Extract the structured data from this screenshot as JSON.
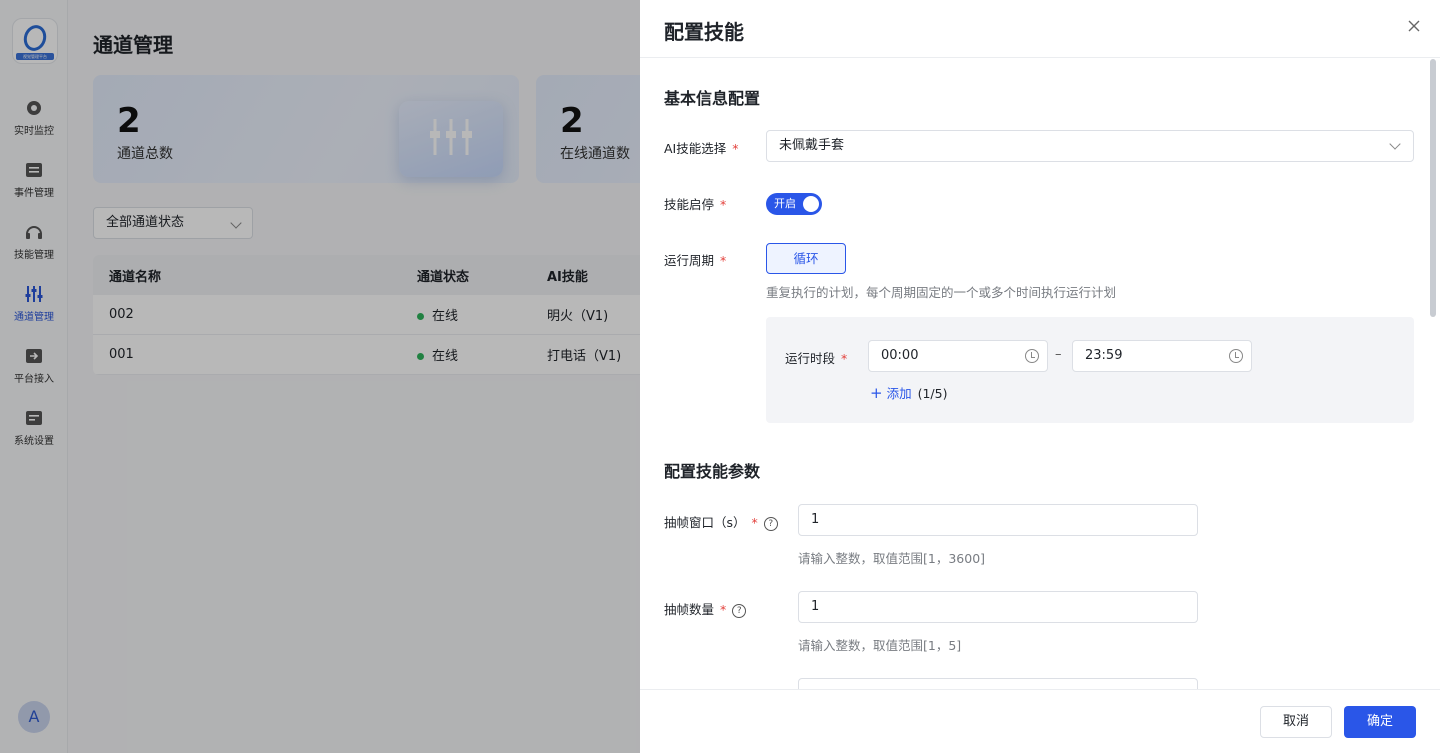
{
  "sidebar": {
    "logo_subtitle": "视觉管理平台",
    "items": [
      {
        "label": "实时监控",
        "icon": "camera-icon"
      },
      {
        "label": "事件管理",
        "icon": "list-icon"
      },
      {
        "label": "技能管理",
        "icon": "headset-icon"
      },
      {
        "label": "通道管理",
        "icon": "sliders-icon"
      },
      {
        "label": "平台接入",
        "icon": "login-icon"
      },
      {
        "label": "系统设置",
        "icon": "settings-icon"
      }
    ],
    "active_item": "通道管理",
    "avatar": "A"
  },
  "main": {
    "title": "通道管理",
    "stats": [
      {
        "value": "2",
        "label": "通道总数"
      },
      {
        "value": "2",
        "label": "在线通道数"
      }
    ],
    "filter": "全部通道状态",
    "table": {
      "headers": [
        "通道名称",
        "通道状态",
        "AI技能"
      ],
      "rows": [
        {
          "name": "002",
          "status": "在线",
          "skill": "明火（V1)"
        },
        {
          "name": "001",
          "status": "在线",
          "skill": "打电话（V1)"
        }
      ]
    }
  },
  "drawer": {
    "title": "配置技能",
    "basic_section": "基本信息配置",
    "ai_skill_label": "AI技能选择",
    "ai_skill_value": "未佩戴手套",
    "toggle_label": "技能启停",
    "toggle_text": "开启",
    "period_label": "运行周期",
    "period_option": "循环",
    "period_hint": "重复执行的计划，每个周期固定的一个或多个时间执行运行计划",
    "time_label": "运行时段",
    "time_start": "00:00",
    "time_sep": "–",
    "time_end": "23:59",
    "add_label": "添加",
    "add_count": "(1/5)",
    "params_section": "配置技能参数",
    "window_label": "抽帧窗口（s）",
    "window_value": "1",
    "window_hint": "请输入整数，取值范围[1，3600]",
    "count_label": "抽帧数量",
    "count_value": "1",
    "count_hint": "请输入整数，取值范围[1，5]",
    "cancel": "取消",
    "confirm": "确定"
  },
  "colors": {
    "primary": "#2a56e8",
    "online": "#2fb35c",
    "required": "#e3413c"
  }
}
